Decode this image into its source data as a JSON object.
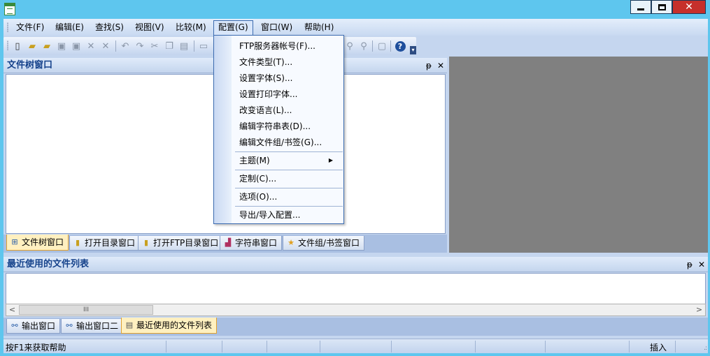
{
  "menubar": {
    "items": [
      {
        "label": "文件(F)"
      },
      {
        "label": "编辑(E)"
      },
      {
        "label": "查找(S)"
      },
      {
        "label": "视图(V)"
      },
      {
        "label": "比较(M)"
      },
      {
        "label": "配置(G)"
      },
      {
        "label": "窗口(W)"
      },
      {
        "label": "帮助(H)"
      }
    ]
  },
  "config_menu": {
    "items": [
      {
        "label": "FTP服务器帐号(F)..."
      },
      {
        "label": "文件类型(T)..."
      },
      {
        "label": "设置字体(S)..."
      },
      {
        "label": "设置打印字体..."
      },
      {
        "label": "改变语言(L)..."
      },
      {
        "label": "编辑字符串表(D)..."
      },
      {
        "label": "编辑文件组/书签(G)..."
      },
      {
        "label": "主题(M)"
      },
      {
        "label": "定制(C)..."
      },
      {
        "label": "选项(O)..."
      },
      {
        "label": "导出/导入配置..."
      }
    ]
  },
  "file_tree": {
    "title": "文件树窗口",
    "pin": "ᵽ",
    "close": "✕"
  },
  "left_tabs": [
    {
      "label": "文件树窗口",
      "icon": "file-tree-icon"
    },
    {
      "label": "打开目录窗口",
      "icon": "open-folder-icon"
    },
    {
      "label": "打开FTP目录窗口",
      "icon": "ftp-folder-icon"
    },
    {
      "label": "字符串窗口",
      "icon": "string-icon"
    },
    {
      "label": "文件组/书签窗口",
      "icon": "bookmark-star-icon"
    }
  ],
  "recent_files": {
    "title": "最近使用的文件列表",
    "scroll_thumb": "III"
  },
  "bottom_tabs": [
    {
      "label": "输出窗口",
      "icon": "output-icon"
    },
    {
      "label": "输出窗口二",
      "icon": "output-icon"
    },
    {
      "label": "最近使用的文件列表",
      "icon": "recent-list-icon"
    }
  ],
  "statusbar": {
    "help_text": "按F1来获取帮助",
    "insert_mode": "插入"
  },
  "colors": {
    "title_bar": "#5ec6ee",
    "accent": "#15428b",
    "mdi_background": "#808080",
    "close_button": "#c6302b"
  }
}
